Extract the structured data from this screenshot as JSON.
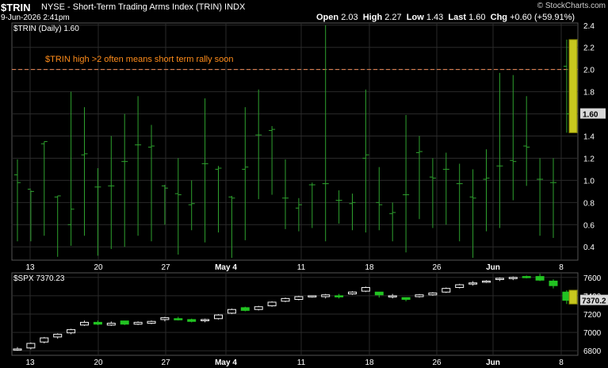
{
  "header": {
    "symbol": "$TRIN",
    "name": "NYSE - Short-Term Trading Arms Index (TRIN) INDX",
    "datetime": "9-Jun-2026 2:41pm",
    "brand": "© StockCharts.com",
    "open_label": "Open",
    "open": "2.03",
    "high_label": "High",
    "high": "2.27",
    "low_label": "Low",
    "low": "1.43",
    "last_label": "Last",
    "last": "1.60",
    "chg_label": "Chg",
    "chg": "+0.60 (+59.91%)"
  },
  "colors": {
    "background": "#000000",
    "grid": "#2a2a2a",
    "trin_bars": "#2ea02e",
    "spx_up": "#f5f5f5",
    "spx_down": "#22c322",
    "threshold_line": "#f08c5a",
    "annotation": "#ff8c1a",
    "last_highlight": "#c8c81e"
  },
  "chart_data": [
    {
      "type": "ohlc",
      "legend": "$TRIN (Daily) 1.60",
      "annotation": "$TRIN high >2 often means short term rally soon",
      "threshold": 2.0,
      "last_value_label": "1.60",
      "ylim": [
        0.28,
        2.42
      ],
      "yticks": [
        "0.4",
        "0.6",
        "0.8",
        "1.0",
        "1.2",
        "1.4",
        "1.6",
        "1.8",
        "2.0",
        "2.2",
        "2.4"
      ],
      "xtick_labels": [
        "13",
        "20",
        "27",
        "May 4",
        "11",
        "18",
        "26",
        "Jun",
        "8"
      ],
      "x": [
        1,
        2,
        3,
        4,
        5,
        6,
        7,
        8,
        9,
        10,
        11,
        12,
        13,
        14,
        15,
        16,
        17,
        18,
        19,
        20,
        21,
        22,
        23,
        24,
        25,
        26,
        27,
        28,
        29,
        30,
        31,
        32,
        33,
        34,
        35,
        36,
        37,
        38,
        39,
        40,
        41,
        42
      ],
      "ohlc": [
        [
          1.05,
          1.19,
          0.45,
          0.98
        ],
        [
          0.92,
          0.91,
          0.45,
          0.9
        ],
        [
          1.33,
          1.35,
          0.5,
          1.35
        ],
        [
          0.85,
          0.86,
          0.31,
          0.86
        ],
        [
          0.6,
          1.8,
          0.41,
          0.74
        ],
        [
          1.23,
          1.66,
          0.5,
          1.24
        ],
        [
          0.94,
          1.11,
          0.32,
          0.94
        ],
        [
          0.95,
          1.4,
          0.38,
          0.95
        ],
        [
          1.17,
          1.6,
          0.4,
          1.17
        ],
        [
          1.32,
          1.76,
          0.5,
          1.32
        ],
        [
          1.3,
          1.5,
          0.45,
          1.31
        ],
        [
          0.95,
          0.96,
          0.6,
          0.93
        ],
        [
          0.88,
          1.2,
          0.33,
          0.87
        ],
        [
          0.78,
          1.0,
          0.55,
          0.79
        ],
        [
          1.15,
          1.74,
          0.44,
          1.15
        ],
        [
          1.1,
          1.13,
          0.53,
          1.11
        ],
        [
          0.85,
          0.86,
          0.3,
          0.84
        ],
        [
          1.1,
          1.66,
          0.46,
          1.12
        ],
        [
          1.41,
          1.82,
          0.83,
          1.41
        ],
        [
          1.45,
          1.49,
          0.87,
          1.46
        ],
        [
          0.84,
          1.19,
          0.56,
          0.84
        ],
        [
          0.75,
          0.84,
          0.54,
          0.78
        ],
        [
          0.96,
          0.98,
          0.57,
          0.96
        ],
        [
          0.97,
          2.4,
          0.45,
          0.97
        ],
        [
          0.82,
          0.91,
          0.61,
          0.82
        ],
        [
          0.79,
          0.88,
          0.55,
          0.8
        ],
        [
          1.2,
          1.82,
          0.53,
          1.23
        ],
        [
          0.8,
          1.12,
          0.55,
          0.78
        ],
        [
          0.7,
          0.8,
          0.45,
          0.71
        ],
        [
          0.87,
          1.59,
          0.35,
          0.87
        ],
        [
          1.25,
          1.4,
          0.65,
          1.26
        ],
        [
          1.03,
          1.2,
          0.57,
          1.02
        ],
        [
          1.1,
          1.25,
          0.6,
          1.1
        ],
        [
          0.97,
          1.15,
          0.45,
          0.97
        ],
        [
          0.85,
          1.1,
          0.3,
          0.84
        ],
        [
          1.01,
          1.28,
          0.54,
          1.02
        ],
        [
          1.13,
          1.97,
          0.57,
          1.13
        ],
        [
          1.18,
          1.95,
          0.82,
          1.17
        ],
        [
          1.31,
          1.76,
          0.95,
          1.3
        ],
        [
          1.01,
          1.2,
          0.5,
          1.01
        ],
        [
          0.98,
          1.2,
          0.48,
          0.98
        ],
        [
          2.03,
          2.27,
          1.43,
          1.6
        ]
      ]
    },
    {
      "type": "candlestick",
      "legend": "$SPX 7370.23",
      "last_value_label": "7370.2",
      "ylim": [
        6750,
        7650
      ],
      "yticks": [
        "6800",
        "7000",
        "7200",
        "7400",
        "7600"
      ],
      "xtick_labels": [
        "13",
        "20",
        "27",
        "May 4",
        "11",
        "18",
        "26",
        "Jun",
        "8"
      ],
      "x": [
        1,
        2,
        3,
        4,
        5,
        6,
        7,
        8,
        9,
        10,
        11,
        12,
        13,
        14,
        15,
        16,
        17,
        18,
        19,
        20,
        21,
        22,
        23,
        24,
        25,
        26,
        27,
        28,
        29,
        30,
        31,
        32,
        33,
        34,
        35,
        36,
        37,
        38,
        39,
        40,
        41,
        42
      ],
      "ohlc": [
        [
          6810,
          6840,
          6800,
          6820
        ],
        [
          6830,
          6890,
          6815,
          6880
        ],
        [
          6895,
          6950,
          6880,
          6940
        ],
        [
          6950,
          6990,
          6930,
          6980
        ],
        [
          6995,
          7040,
          6980,
          7030
        ],
        [
          7080,
          7130,
          7070,
          7110
        ],
        [
          7110,
          7130,
          7080,
          7090
        ],
        [
          7080,
          7120,
          7070,
          7100
        ],
        [
          7125,
          7120,
          7080,
          7090
        ],
        [
          7090,
          7120,
          7080,
          7110
        ],
        [
          7100,
          7130,
          7090,
          7120
        ],
        [
          7140,
          7170,
          7120,
          7160
        ],
        [
          7150,
          7170,
          7130,
          7140
        ],
        [
          7140,
          7150,
          7110,
          7120
        ],
        [
          7130,
          7150,
          7110,
          7140
        ],
        [
          7150,
          7200,
          7140,
          7190
        ],
        [
          7210,
          7260,
          7200,
          7250
        ],
        [
          7270,
          7280,
          7230,
          7240
        ],
        [
          7250,
          7290,
          7240,
          7280
        ],
        [
          7290,
          7340,
          7280,
          7330
        ],
        [
          7340,
          7380,
          7330,
          7370
        ],
        [
          7360,
          7400,
          7350,
          7390
        ],
        [
          7390,
          7400,
          7380,
          7400
        ],
        [
          7390,
          7420,
          7370,
          7410
        ],
        [
          7400,
          7420,
          7370,
          7390
        ],
        [
          7420,
          7450,
          7410,
          7440
        ],
        [
          7450,
          7500,
          7440,
          7490
        ],
        [
          7440,
          7420,
          7380,
          7410
        ],
        [
          7390,
          7420,
          7370,
          7400
        ],
        [
          7380,
          7370,
          7340,
          7360
        ],
        [
          7390,
          7420,
          7380,
          7410
        ],
        [
          7410,
          7440,
          7400,
          7430
        ],
        [
          7440,
          7490,
          7430,
          7480
        ],
        [
          7490,
          7530,
          7480,
          7520
        ],
        [
          7530,
          7560,
          7510,
          7540
        ],
        [
          7550,
          7570,
          7540,
          7560
        ],
        [
          7580,
          7600,
          7560,
          7590
        ],
        [
          7590,
          7610,
          7570,
          7600
        ],
        [
          7610,
          7620,
          7590,
          7600
        ],
        [
          7610,
          7640,
          7560,
          7570
        ],
        [
          7560,
          7580,
          7480,
          7510
        ],
        [
          7440,
          7460,
          7310,
          7350
        ]
      ]
    }
  ]
}
